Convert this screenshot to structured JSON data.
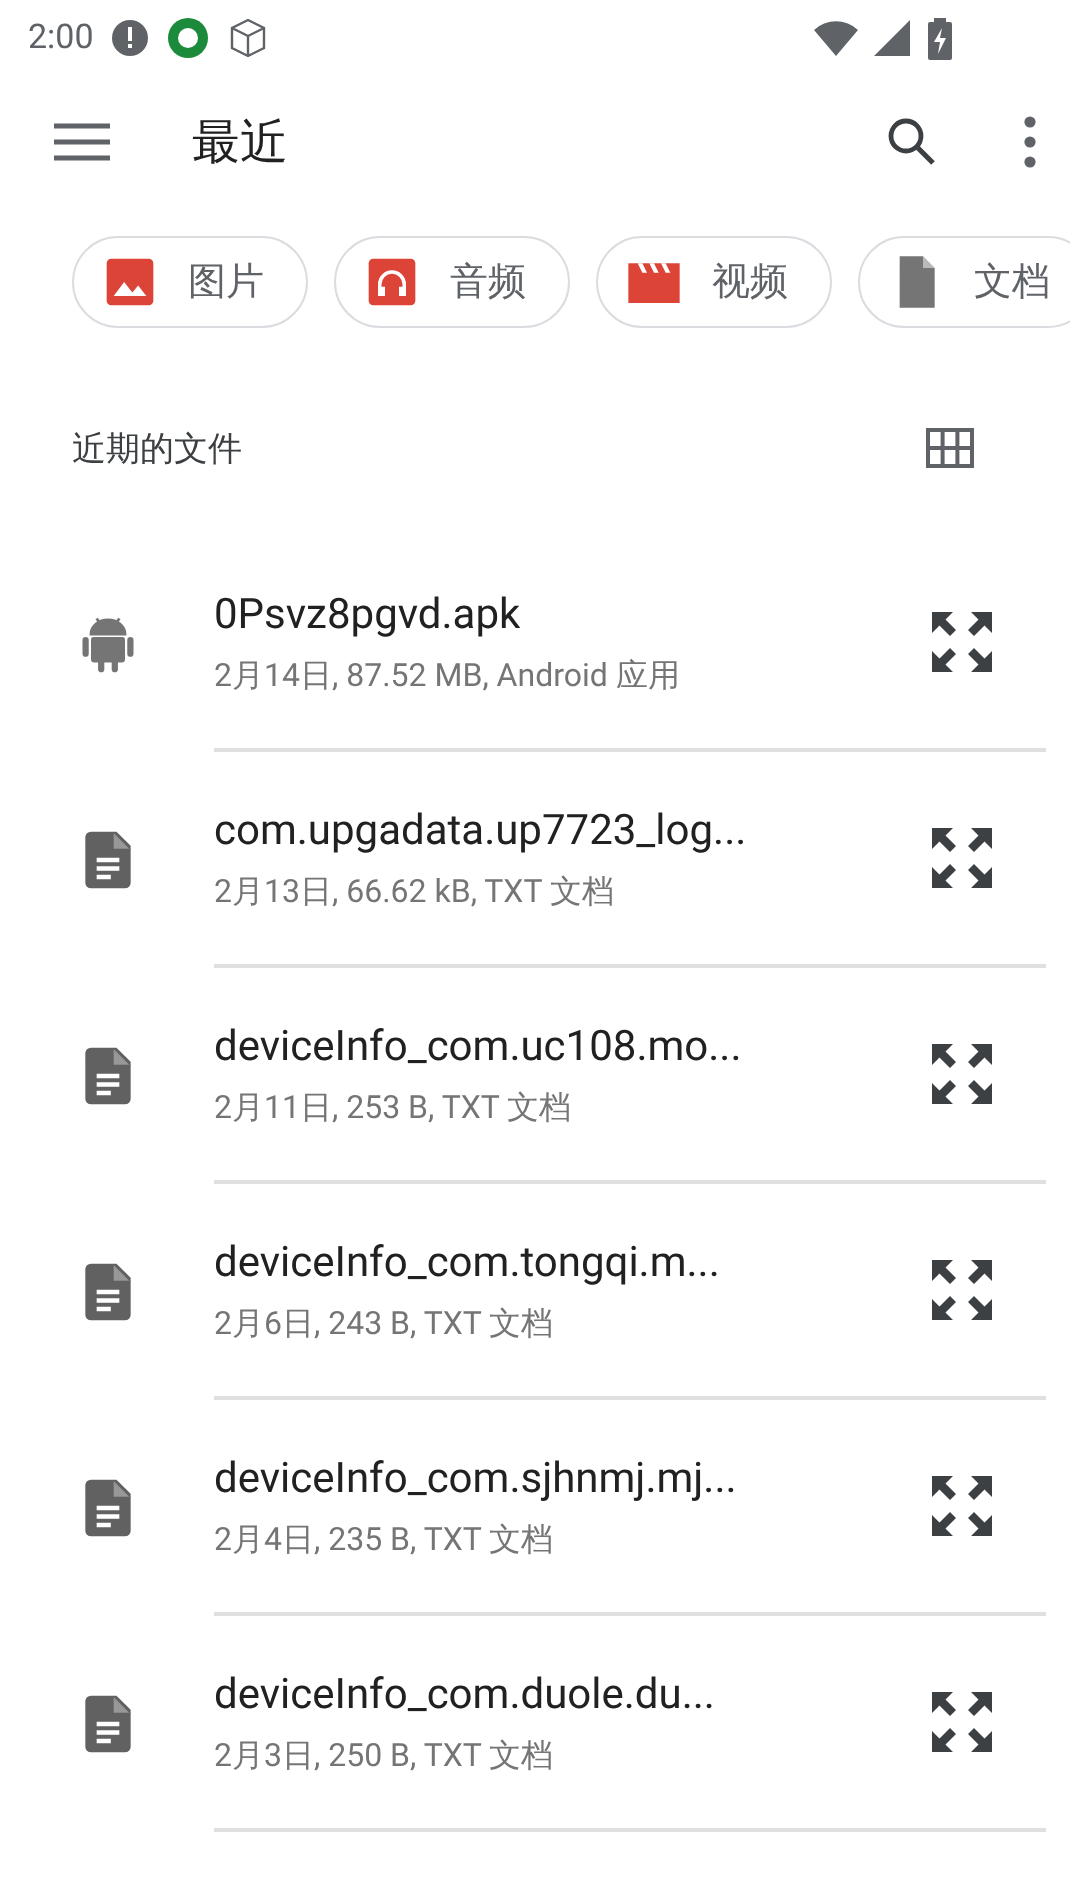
{
  "status_bar": {
    "time": "2:00"
  },
  "toolbar": {
    "title": "最近"
  },
  "chips": [
    {
      "label": "图片",
      "kind": "image"
    },
    {
      "label": "音频",
      "kind": "audio"
    },
    {
      "label": "视频",
      "kind": "video"
    },
    {
      "label": "文档",
      "kind": "document"
    }
  ],
  "section": {
    "title": "近期的文件"
  },
  "files": [
    {
      "name": "0Psvz8pgvd.apk",
      "details": "2月14日, 87.52 MB, Android 应用",
      "kind": "apk"
    },
    {
      "name": "com.upgadata.up7723_log...",
      "details": "2月13日, 66.62 kB, TXT 文档",
      "kind": "text"
    },
    {
      "name": "deviceInfo_com.uc108.mo...",
      "details": "2月11日, 253 B, TXT 文档",
      "kind": "text"
    },
    {
      "name": "deviceInfo_com.tongqi.m...",
      "details": "2月6日, 243 B, TXT 文档",
      "kind": "text"
    },
    {
      "name": "deviceInfo_com.sjhnmj.mj...",
      "details": "2月4日, 235 B, TXT 文档",
      "kind": "text"
    },
    {
      "name": "deviceInfo_com.duole.du...",
      "details": "2月3日, 250 B, TXT 文档",
      "kind": "text"
    }
  ]
}
